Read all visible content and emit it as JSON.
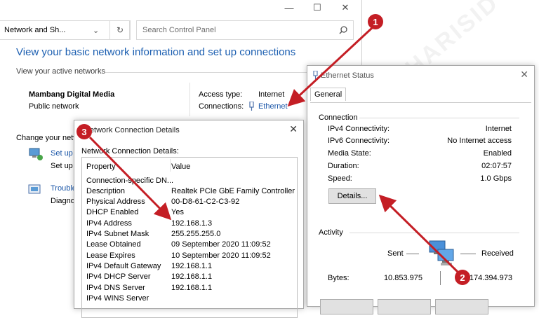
{
  "main": {
    "caption": {
      "minimize": "—",
      "maximize": "☐",
      "close": "✕"
    },
    "breadcrumb": "Network and Sh...",
    "search_placeholder": "Search Control Panel",
    "heading": "View your basic network information and set up connections",
    "active_networks_label": "View your active networks",
    "network_name": "Mambang Digital Media",
    "network_type": "Public network",
    "access_type_label": "Access type:",
    "access_type_value": "Internet",
    "connections_label": "Connections:",
    "connections_value": "Ethernet",
    "change_settings_label": "Change your netw",
    "setup_link": "Set up",
    "setup_desc": "Set up",
    "trouble_link": "Trouble",
    "trouble_desc": "Diagno"
  },
  "ethernet_status": {
    "title": "Ethernet Status",
    "tab": "General",
    "connection_group": "Connection",
    "rows": [
      {
        "label": "IPv4 Connectivity:",
        "value": "Internet"
      },
      {
        "label": "IPv6 Connectivity:",
        "value": "No Internet access"
      },
      {
        "label": "Media State:",
        "value": "Enabled"
      },
      {
        "label": "Duration:",
        "value": "02:07:57"
      },
      {
        "label": "Speed:",
        "value": "1.0 Gbps"
      }
    ],
    "details_button": "Details...",
    "activity_group": "Activity",
    "sent_label": "Sent",
    "received_label": "Received",
    "bytes_label": "Bytes:",
    "bytes_sent": "10.853.975",
    "bytes_received": "174.394.973"
  },
  "details": {
    "title": "Network Connection Details",
    "list_label": "Network Connection Details:",
    "col_property": "Property",
    "col_value": "Value",
    "rows": [
      {
        "property": "Connection-specific DN...",
        "value": ""
      },
      {
        "property": "Description",
        "value": "Realtek PCIe GbE Family Controller"
      },
      {
        "property": "Physical Address",
        "value": "00-D8-61-C2-C3-92"
      },
      {
        "property": "DHCP Enabled",
        "value": "Yes"
      },
      {
        "property": "IPv4 Address",
        "value": "192.168.1.3"
      },
      {
        "property": "IPv4 Subnet Mask",
        "value": "255.255.255.0"
      },
      {
        "property": "Lease Obtained",
        "value": "09 September 2020 11:09:52"
      },
      {
        "property": "Lease Expires",
        "value": "10 September 2020 11:09:52"
      },
      {
        "property": "IPv4 Default Gateway",
        "value": "192.168.1.1"
      },
      {
        "property": "IPv4 DHCP Server",
        "value": "192.168.1.1"
      },
      {
        "property": "IPv4 DNS Server",
        "value": "192.168.1.1"
      },
      {
        "property": "IPv4 WINS Server",
        "value": ""
      }
    ]
  },
  "markers": [
    "1",
    "2",
    "3"
  ],
  "watermark": "CHARISID"
}
